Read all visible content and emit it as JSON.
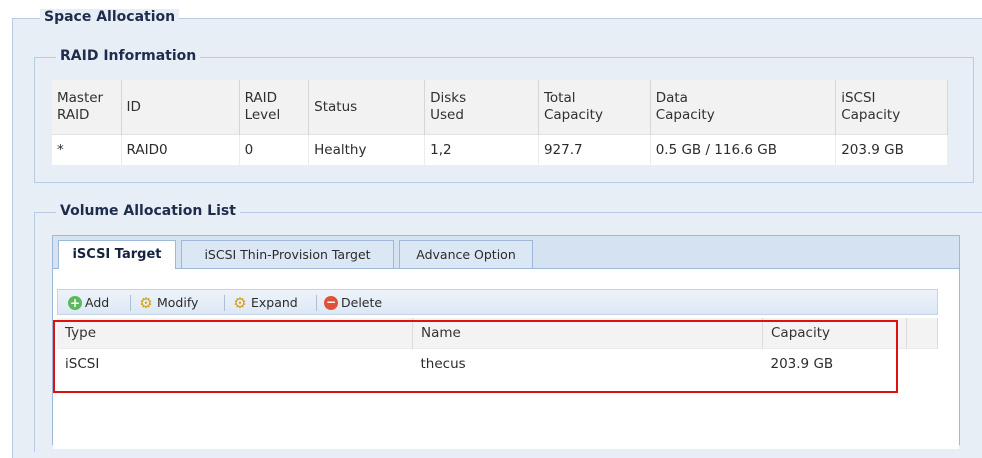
{
  "space_allocation": {
    "legend": "Space Allocation"
  },
  "raid_info": {
    "legend": "RAID Information",
    "columns": [
      {
        "line1": "Master",
        "line2": "RAID"
      },
      {
        "line1": "ID",
        "line2": ""
      },
      {
        "line1": "RAID",
        "line2": "Level"
      },
      {
        "line1": "Status",
        "line2": ""
      },
      {
        "line1": "Disks",
        "line2": "Used"
      },
      {
        "line1": "Total",
        "line2": "Capacity"
      },
      {
        "line1": "Data",
        "line2": "Capacity"
      },
      {
        "line1": "iSCSI",
        "line2": "Capacity"
      }
    ],
    "row": {
      "master": "*",
      "id": "RAID0",
      "level": "0",
      "status": "Healthy",
      "disks": "1,2",
      "total": "927.7",
      "data": "0.5 GB / 116.6 GB",
      "iscsi": "203.9 GB"
    }
  },
  "volume_list": {
    "legend": "Volume Allocation List",
    "tabs": [
      {
        "label": "iSCSI Target",
        "active": true
      },
      {
        "label": "iSCSI Thin-Provision Target",
        "active": false
      },
      {
        "label": "Advance Option",
        "active": false
      }
    ],
    "toolbar": {
      "add": "Add",
      "modify": "Modify",
      "expand": "Expand",
      "delete": "Delete"
    },
    "columns": {
      "type": "Type",
      "name": "Name",
      "capacity": "Capacity"
    },
    "rows": [
      {
        "type": "iSCSI",
        "name": "thecus",
        "capacity": "203.9 GB"
      }
    ]
  },
  "colors": {
    "highlight": "#e01010",
    "panel_bg": "#e8eef6",
    "border": "#b9cbe3"
  }
}
